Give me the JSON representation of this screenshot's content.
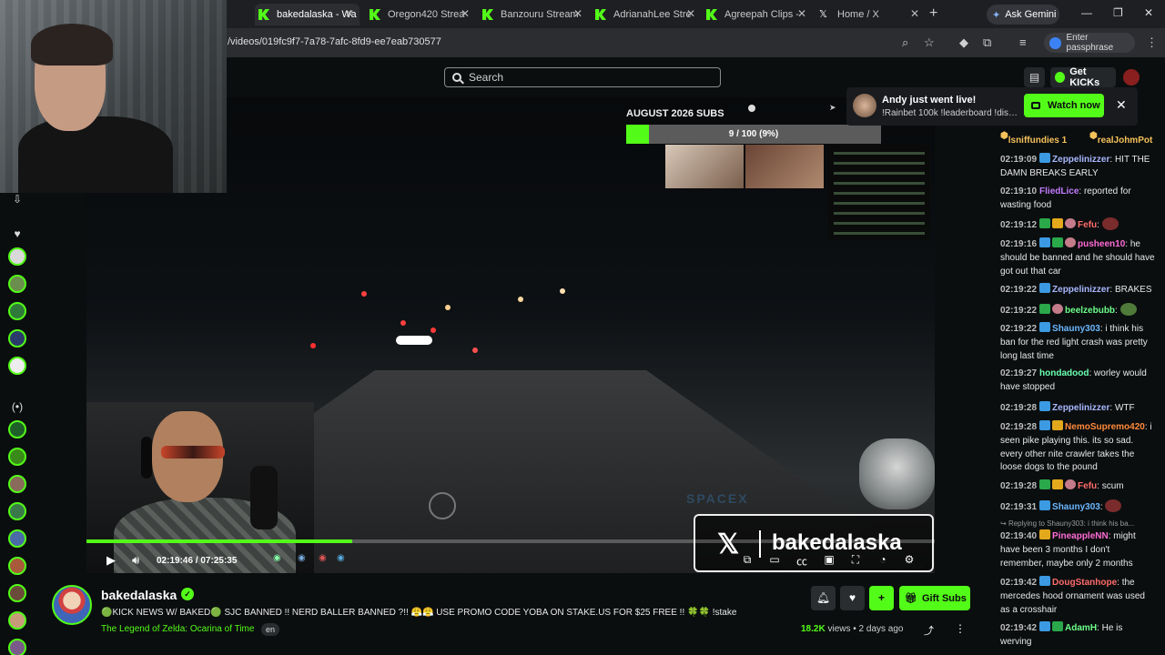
{
  "browser": {
    "tabs": [
      {
        "label": "bakedalaska - Wa",
        "active": true
      },
      {
        "label": "Oregon420 Strea",
        "active": false
      },
      {
        "label": "Banzouru Stream",
        "active": false
      },
      {
        "label": "AdrianahLee Stre",
        "active": false
      },
      {
        "label": "Agreepah Clips -",
        "active": false
      },
      {
        "label": "Home / X",
        "active": false
      }
    ],
    "new_tab": "+",
    "gemini_label": "Ask Gemini",
    "url": "/videos/019fc9f7-7a78-7afc-8fd9-ee7eab730577",
    "passphrase_label": "Enter passphrase"
  },
  "header": {
    "search_placeholder": "Search",
    "get_kicks_label": "Get KICKs"
  },
  "notification": {
    "title": "Andy just went live!",
    "subtitle": "!Rainbet 100k !leaderboard !discor...",
    "watch_label": "Watch now",
    "close": "✕"
  },
  "overlay": {
    "subs_title": "AUGUST 2026 SUBS",
    "subs_progress_text": "9 / 100 (9%)",
    "subs_fraction": 0.09,
    "brand_name": "bakedalaska",
    "spacex": "SPACEX"
  },
  "player": {
    "current_time": "02:19:46",
    "duration": "07:25:35",
    "progress_fraction": 0.313
  },
  "chat": {
    "pinned": [
      "lsniffundies 1",
      "realJohmPot"
    ],
    "messages": [
      {
        "time": "02:19:09",
        "badges": [
          "sub"
        ],
        "user": "Zeppelinizzer",
        "color": "#a8b8ff",
        "text": "HIT THE DAMN BREAKS EARLY"
      },
      {
        "time": "02:19:10",
        "badges": [],
        "user": "FliedLice",
        "color": "#c27cff",
        "text": "reported for wasting food"
      },
      {
        "time": "02:19:12",
        "badges": [
          "g",
          "crown",
          "icon"
        ],
        "user": "Fefu",
        "color": "#ff6b6b",
        "text": ""
      },
      {
        "time": "02:19:16",
        "badges": [
          "sub",
          "g",
          "icon"
        ],
        "user": "pusheen10",
        "color": "#ff6bd6",
        "text": "he should be banned and he should have got out that car"
      },
      {
        "time": "02:19:22",
        "badges": [
          "sub"
        ],
        "user": "Zeppelinizzer",
        "color": "#a8b8ff",
        "text": "BRAKES"
      },
      {
        "time": "02:19:22",
        "badges": [
          "g",
          "icon"
        ],
        "user": "beelzebubb",
        "color": "#6bff8a",
        "text": ""
      },
      {
        "time": "02:19:22",
        "badges": [
          "sub"
        ],
        "user": "Shauny303",
        "color": "#6bb8ff",
        "text": "i think his ban for the red light crash was pretty long last time"
      },
      {
        "time": "02:19:27",
        "badges": [],
        "user": "hondadood",
        "color": "#6bffb0",
        "text": "worley would have stopped"
      },
      {
        "time": "02:19:28",
        "badges": [
          "sub"
        ],
        "user": "Zeppelinizzer",
        "color": "#a8b8ff",
        "text": "WTF"
      },
      {
        "time": "02:19:28",
        "badges": [
          "sub",
          "crown"
        ],
        "user": "NemoSupremo420",
        "color": "#ff8a3a",
        "text": "i seen pike playing this. its so sad. every other nite crawler takes the loose dogs to the pound"
      },
      {
        "time": "02:19:28",
        "badges": [
          "g",
          "crown",
          "icon"
        ],
        "user": "Fefu",
        "color": "#ff6b6b",
        "text": "scum"
      },
      {
        "time": "02:19:31",
        "badges": [
          "sub"
        ],
        "user": "Shauny303",
        "color": "#6bb8ff",
        "text": ""
      },
      {
        "time": "02:19:40",
        "badges": [
          "crown"
        ],
        "user": "PineappleNN",
        "color": "#ff6bd6",
        "text": "might have been 3 months I don't remember, maybe only 2 months"
      },
      {
        "time": "02:19:42",
        "badges": [
          "sub"
        ],
        "user": "DougStanhope",
        "color": "#ff6b6b",
        "text": "the mercedes hood ornament was used as a crosshair"
      },
      {
        "time": "02:19:42",
        "badges": [
          "sub",
          "g"
        ],
        "user": "AdamH",
        "color": "#6bff8a",
        "text": "He is werving"
      }
    ],
    "reply_text": "Replying to Shauny303: i think his ba..."
  },
  "channel": {
    "name": "bakedalaska",
    "title": "🟢KICK NEWS W/ BAKED🟢 SJC BANNED !! NERD BALLER BANNED ?!! 😤😤  USE PROMO CODE YOBA ON STAKE.US FOR $25 FREE !! 🍀🍀 !stake",
    "game": "The Legend of Zelda: Ocarina of Time",
    "language": "en",
    "views": "18.2K",
    "views_suffix": "views",
    "age": "2 days ago",
    "gift_subs_label": "Gift Subs"
  },
  "colors": {
    "accent": "#53fc18",
    "background": "#0b0e0f"
  }
}
